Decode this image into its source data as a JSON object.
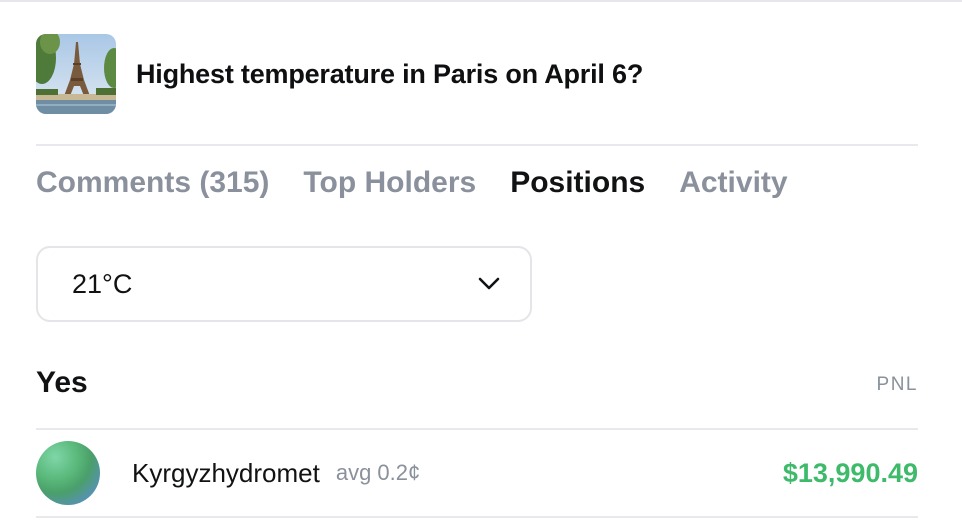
{
  "market": {
    "title": "Highest temperature in Paris on April 6?",
    "image_icon": "eiffel-tower-thumbnail"
  },
  "tabs": [
    {
      "label": "Comments (315)",
      "active": false
    },
    {
      "label": "Top Holders",
      "active": false
    },
    {
      "label": "Positions",
      "active": true
    },
    {
      "label": "Activity",
      "active": false
    }
  ],
  "outcome_select": {
    "value": "21°C",
    "icon": "chevron-down-icon"
  },
  "positions": {
    "outcome_label": "Yes",
    "pnl_header": "PNL",
    "rows": [
      {
        "holder": "Kyrgyzhydromet",
        "avg": "avg 0.2¢",
        "pnl": "$13,990.49"
      }
    ]
  },
  "colors": {
    "pnl_positive": "#3dba6a",
    "muted": "#8a919c",
    "text": "#111214",
    "border": "#e4e5e8"
  }
}
